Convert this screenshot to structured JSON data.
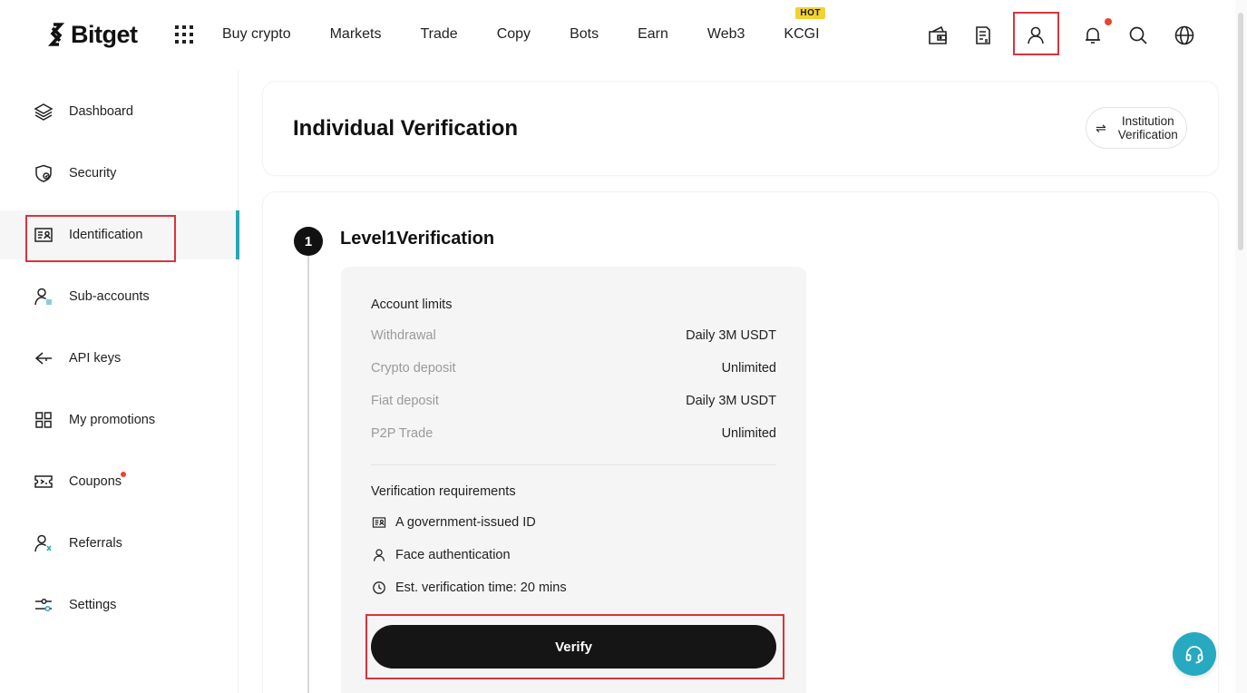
{
  "brand": {
    "name": "Bitget"
  },
  "nav": {
    "items": [
      {
        "label": "Buy crypto"
      },
      {
        "label": "Markets"
      },
      {
        "label": "Trade"
      },
      {
        "label": "Copy"
      },
      {
        "label": "Bots"
      },
      {
        "label": "Earn"
      },
      {
        "label": "Web3"
      },
      {
        "label": "KCGI",
        "badge": "HOT"
      }
    ],
    "icons": [
      "apps-grid-icon",
      "wallet-icon",
      "orders-icon",
      "user-icon",
      "bell-icon",
      "search-icon",
      "globe-icon"
    ]
  },
  "sidebar": {
    "items": [
      {
        "label": "Dashboard",
        "icon": "layers-icon"
      },
      {
        "label": "Security",
        "icon": "shield-icon"
      },
      {
        "label": "Identification",
        "icon": "id-card-icon",
        "active": true
      },
      {
        "label": "Sub-accounts",
        "icon": "sub-accounts-icon"
      },
      {
        "label": "API keys",
        "icon": "api-key-icon"
      },
      {
        "label": "My promotions",
        "icon": "promotions-icon"
      },
      {
        "label": "Coupons",
        "icon": "coupon-icon",
        "dot": true
      },
      {
        "label": "Referrals",
        "icon": "referrals-icon"
      },
      {
        "label": "Settings",
        "icon": "settings-sliders-icon"
      }
    ]
  },
  "header": {
    "title": "Individual Verification",
    "institution_button": "Institution Verification"
  },
  "level": {
    "step_number": "1",
    "title": "Level1Verification",
    "limits_heading": "Account limits",
    "limits": [
      {
        "name": "Withdrawal",
        "value": "Daily 3M USDT"
      },
      {
        "name": "Crypto deposit",
        "value": "Unlimited"
      },
      {
        "name": "Fiat deposit",
        "value": "Daily 3M USDT"
      },
      {
        "name": "P2P Trade",
        "value": "Unlimited"
      }
    ],
    "requirements_heading": "Verification requirements",
    "requirements": [
      {
        "text": "A government-issued ID",
        "icon": "id-card-icon"
      },
      {
        "text": "Face authentication",
        "icon": "user-icon"
      },
      {
        "text": "Est. verification time: 20 mins",
        "icon": "clock-icon"
      }
    ],
    "verify_button": "Verify"
  },
  "colors": {
    "accent": "#28a8b6",
    "button": "#151515",
    "highlight": "#d9333d",
    "hot_badge": "#f3d230",
    "support": "#27a9c1"
  }
}
